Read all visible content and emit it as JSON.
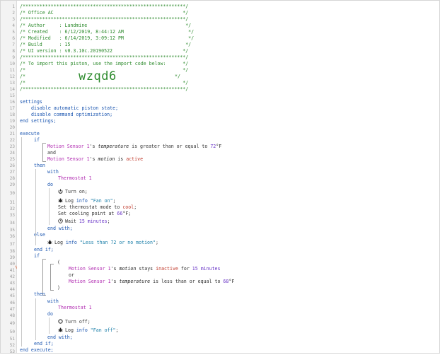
{
  "line_numbers": [
    "1",
    "2",
    "3",
    "4",
    "5",
    "6",
    "7",
    "8",
    "9",
    "10",
    "11",
    "12",
    "13",
    "14",
    "15",
    "16",
    "17",
    "18",
    "19",
    "20",
    "21",
    "22",
    "23",
    "24",
    "25",
    "26",
    "27",
    "28",
    "29",
    "30",
    "31",
    "32",
    "33",
    "34",
    "35",
    "36",
    "37",
    "38",
    "39",
    "40",
    "41",
    "42",
    "43",
    "44",
    "45",
    "46",
    "47",
    "48",
    "49",
    "50",
    "51",
    "52",
    "53",
    "54"
  ],
  "header": {
    "border": "/**********************************************************/",
    "title": "/* Office AC                                              */",
    "author": "/* Author     : Landmine                                   */",
    "created": "/* Created    : 6/12/2019, 8:44:12 AM                       */",
    "modified": "/* Modified   : 6/14/2019, 3:09:12 PM                       */",
    "build": "/* Build      : 15                                         */",
    "ui_version": "/* UI version : v0.3.10c.20190522                         */",
    "import_note": "/* To import this piston, use the import code below:      */",
    "blank": "/*                                                        */",
    "code_left": "/*",
    "code_right": "*/",
    "import_code": "wzqd6"
  },
  "settings": {
    "open": "settings",
    "line1": "disable automatic piston state;",
    "line2": "disable command optimization;",
    "close": "end settings;"
  },
  "execute": {
    "open": "execute",
    "close": "end execute;",
    "if_kw": "if",
    "then_kw": "then",
    "else_kw": "else",
    "end_if": "end if;",
    "with_kw": "with",
    "do_kw": "do",
    "end_with": "end with;",
    "and_kw": "and",
    "or_kw": "or",
    "open_paren": "(",
    "close_paren": ")",
    "device_motion": "Motion Sensor 1",
    "device_thermo": "Thermostat 1",
    "possessive": "'s",
    "temperature": "temperature",
    "motion": "motion",
    "cond1_op": "is greater than or equal to",
    "cond1_val": "72",
    "unit_f": "°F",
    "cond2_op": "is",
    "cond2_val": "active",
    "turn_on": "Turn on;",
    "log_kw": "Log",
    "info_kw": "info",
    "log_fan_on": "\"Fan on\"",
    "semi": ";",
    "set_mode": "Set thermostat mode to",
    "mode_val": "cool",
    "set_cool": "Set cooling point at",
    "cool_val": "66",
    "wait": "Wait",
    "wait_val": "15 minutes",
    "log_else": "\"Less than 72 or no motion\"",
    "cond3_op": "stays",
    "cond3_val": "inactive",
    "cond3_for": "for",
    "cond3_dur": "15 minutes",
    "cond4_op": "is less than or equal to",
    "cond4_val": "68",
    "turn_off": "Turn off;",
    "log_fan_off": "\"Fan off\"",
    "trigger_marker": "ϟ"
  }
}
